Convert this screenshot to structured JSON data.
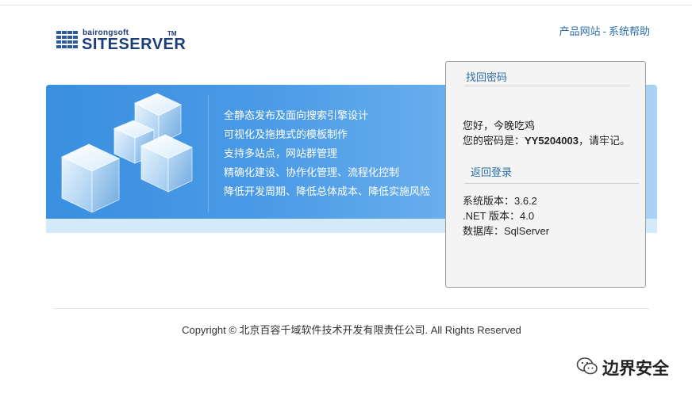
{
  "logo": {
    "small": "bairongsoft",
    "main": "SITESERVER",
    "tm": "TM"
  },
  "top_links": {
    "product_site": "产品网站",
    "separator": "-",
    "help": "系统帮助"
  },
  "banner": {
    "features": [
      "全静态发布及面向搜索引擎设计",
      "可视化及拖拽式的模板制作",
      "支持多站点，网站群管理",
      "精确化建设、协作化管理、流程化控制",
      "降低开发周期、降低总体成本、降低实施风险"
    ]
  },
  "panel": {
    "title": "找回密码",
    "greeting": "您好，今晚吃鸡",
    "password_prefix": "您的密码是：",
    "password": "YY5204003",
    "password_suffix": "，请牢记。",
    "back_login": "返回登录",
    "info": [
      "系统版本：3.6.2",
      ".NET 版本：4.0",
      "数据库：SqlServer"
    ]
  },
  "footer": {
    "copyright": "Copyright © 北京百容千域软件技术开发有限责任公司. All Rights Reserved"
  },
  "watermark": {
    "text": "边界安全"
  },
  "colors": {
    "link": "#2a6ea8",
    "banner_start": "#3a8fe0",
    "banner_end": "#a9d3f6",
    "brand": "#1c3d75"
  }
}
